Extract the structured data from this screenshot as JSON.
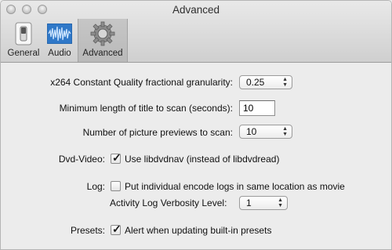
{
  "window": {
    "title": "Advanced"
  },
  "toolbar": {
    "items": [
      {
        "label": "General",
        "icon": "switch-icon"
      },
      {
        "label": "Audio",
        "icon": "waveform-icon"
      },
      {
        "label": "Advanced",
        "icon": "gear-icon"
      }
    ]
  },
  "settings": {
    "granularity": {
      "label": "x264 Constant Quality fractional granularity:",
      "value": "0.25"
    },
    "min_length": {
      "label": "Minimum length of title to scan (seconds):",
      "value": "10"
    },
    "previews": {
      "label": "Number of picture previews to scan:",
      "value": "10"
    },
    "dvd": {
      "label": "Dvd-Video:",
      "checkbox_label": "Use libdvdnav (instead of libdvdread)",
      "checked": true
    },
    "log": {
      "label": "Log:",
      "checkbox_label": "Put individual encode logs in same location as movie",
      "checked": false
    },
    "verbosity": {
      "label": "Activity Log Verbosity Level:",
      "value": "1"
    },
    "presets": {
      "label": "Presets:",
      "checkbox_label": "Alert when updating built-in presets",
      "checked": true
    }
  },
  "colors": {
    "window_bg": "#ececec",
    "waveform_blue": "#2f78c8"
  }
}
